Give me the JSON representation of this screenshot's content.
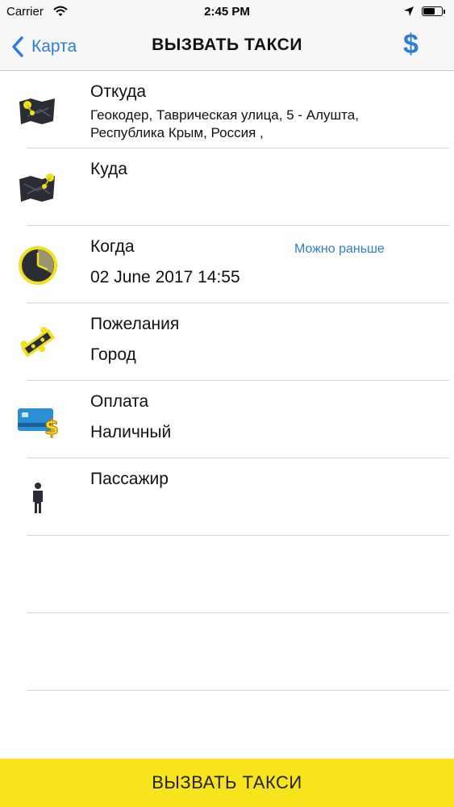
{
  "status_bar": {
    "carrier": "Carrier",
    "time": "2:45 PM",
    "icons": [
      "wifi-icon",
      "location-arrow-icon",
      "battery-icon"
    ]
  },
  "nav": {
    "back_label": "Карта",
    "title": "ВЫЗВАТЬ ТАКСИ",
    "action_symbol": "$",
    "accent_color": "#2f7ddb"
  },
  "rows": [
    {
      "icon": "map-pin-icon",
      "title": "Откуда",
      "value": "Геокодер, Таврическая улица, 5 - Алушта, Республика Крым, Россия ,"
    },
    {
      "icon": "map-pin-icon",
      "title": "Куда",
      "value": ""
    },
    {
      "icon": "clock-icon",
      "title": "Когда",
      "value": "02 June 2017 14:55",
      "link": "Можно раньше"
    },
    {
      "icon": "puzzle-icon",
      "title": "Пожелания",
      "value": "Город"
    },
    {
      "icon": "credit-card-icon",
      "title": "Оплата",
      "value": "Наличный"
    },
    {
      "icon": "passenger-icon",
      "title": "Пассажир",
      "value": ""
    }
  ],
  "call_button": {
    "label": "ВЫЗВАТЬ ТАКСИ",
    "color": "#f7e41c"
  }
}
